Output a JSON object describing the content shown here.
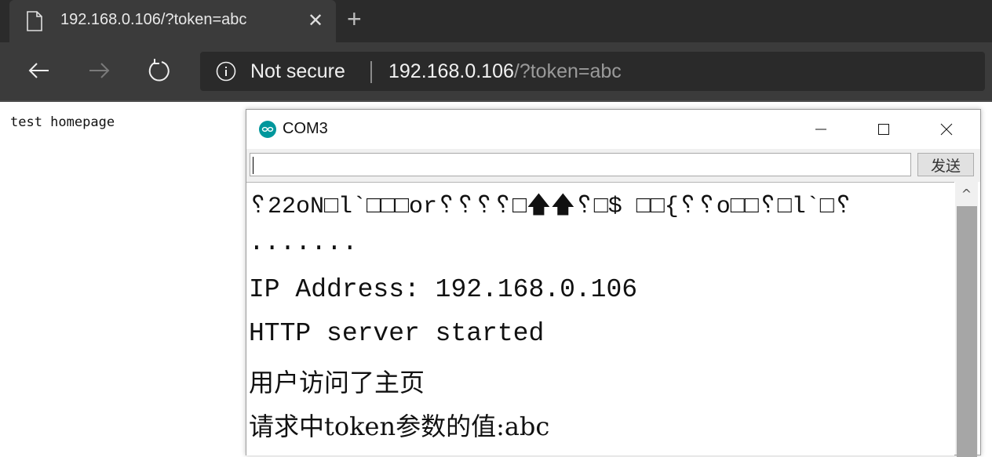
{
  "browser": {
    "tab": {
      "title": "192.168.0.106/?token=abc",
      "close_glyph": "✕",
      "icon": "document-icon"
    },
    "new_tab_glyph": "+",
    "nav": {
      "back_icon": "back-arrow-icon",
      "forward_icon": "forward-arrow-icon",
      "reload_icon": "reload-icon"
    },
    "omnibox": {
      "security_label": "Not secure",
      "url_host": "192.168.0.106",
      "url_rest": "/?token=abc"
    }
  },
  "page": {
    "body_text": "test homepage"
  },
  "serial_monitor": {
    "title": "COM3",
    "icon": "arduino-icon",
    "controls": {
      "minimize": "–",
      "maximize": "☐",
      "close": "✕"
    },
    "input": {
      "value": "",
      "placeholder": ""
    },
    "send_label": "发送",
    "output_lines": [
      "␦22oN□l`□□□or␦␦␦␦□🡅🡅␦□$ □□{␦␦o□□␦□l`□␦",
      ".......",
      "IP Address: 192.168.0.106",
      "HTTP server started",
      "用户访问了主页",
      "请求中token参数的值:abc"
    ],
    "scroll_up_glyph": "^"
  }
}
